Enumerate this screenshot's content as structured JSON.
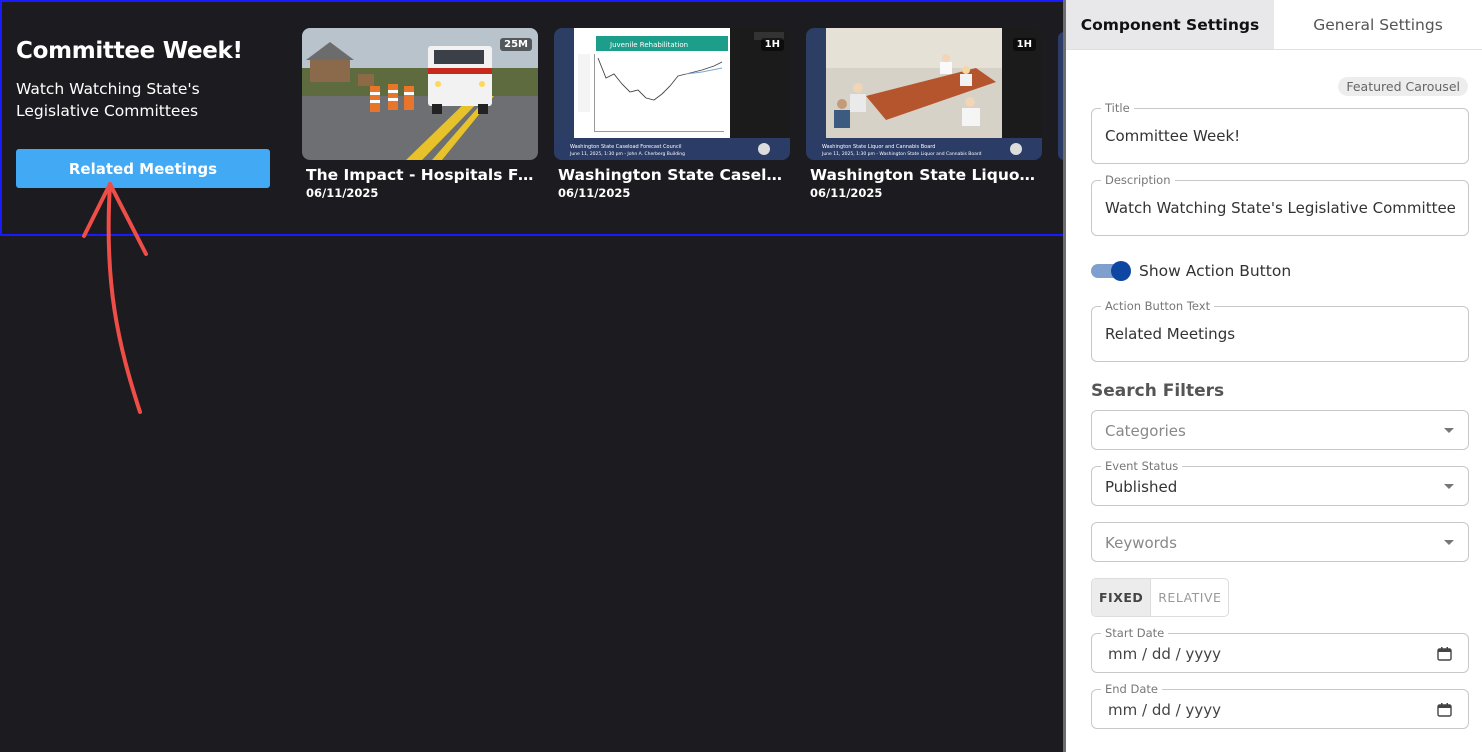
{
  "carousel": {
    "title": "Committee Week!",
    "description": "Watch Watching State's Legislative Committees",
    "action_button": "Related Meetings",
    "cards": [
      {
        "title": "The Impact - Hospitals Fea...",
        "date": "06/11/2025",
        "duration": "25M"
      },
      {
        "title": "Washington State Caseloa...",
        "date": "06/11/2025",
        "duration": "1H",
        "slide_heading": "Juvenile Rehabilitation",
        "caption_line1": "Washington State Caseload Forecast Council",
        "caption_line2": "June 11, 2025, 1:30 pm - John A. Cherberg Building"
      },
      {
        "title": "Washington State Liquor...",
        "date": "06/11/2025",
        "duration": "1H",
        "caption_line1": "Washington State Liquor and Cannabis Board",
        "caption_line2": "June 11, 2025, 1:30 pm - Washington State Liquor and Cannabis Board"
      }
    ]
  },
  "panel": {
    "tabs": [
      {
        "label": "Component Settings",
        "active": true
      },
      {
        "label": "General Settings",
        "active": false
      }
    ],
    "chip": "Featured Carousel",
    "title_field": {
      "label": "Title",
      "value": "Committee Week!"
    },
    "description_field": {
      "label": "Description",
      "value": "Watch Watching State's Legislative Committees"
    },
    "toggle": {
      "label": "Show Action Button",
      "on": true
    },
    "action_text_field": {
      "label": "Action Button Text",
      "value": "Related Meetings"
    },
    "search_filters_heading": "Search Filters",
    "categories": {
      "placeholder": "Categories"
    },
    "event_status": {
      "label": "Event Status",
      "value": "Published"
    },
    "keywords": {
      "placeholder": "Keywords"
    },
    "date_mode": {
      "fixed": "FIXED",
      "relative": "RELATIVE",
      "selected": "FIXED"
    },
    "start_date": {
      "label": "Start Date",
      "placeholder": "mm / dd / yyyy"
    },
    "end_date": {
      "label": "End Date",
      "placeholder": "mm / dd / yyyy"
    }
  },
  "colors": {
    "accent_button": "#42a9f5",
    "toggle_knob": "#0d47a1",
    "selection_border": "#1a1aff",
    "annotation_arrow": "#ef4d47"
  }
}
